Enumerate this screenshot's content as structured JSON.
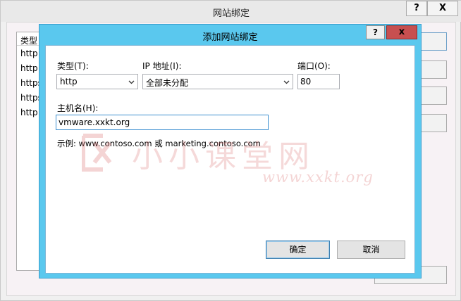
{
  "background_window": {
    "title": "网站绑定",
    "help_label": "?",
    "close_label": "X",
    "list_header": "类型",
    "list_items": [
      "http",
      "http",
      "https",
      "https",
      "http"
    ]
  },
  "dialog": {
    "title": "添加网站绑定",
    "help_label": "?",
    "close_label": "x",
    "type_label": "类型(T):",
    "type_value": "http",
    "ip_label": "IP 地址(I):",
    "ip_value": "全部未分配",
    "port_label": "端口(O):",
    "port_value": "80",
    "host_label": "主机名(H):",
    "host_value": "vmware.xxkt.org",
    "example_text": "示例: www.contoso.com 或 marketing.contoso.com",
    "ok_label": "确定",
    "cancel_label": "取消"
  },
  "watermark": {
    "text": "小小课堂网",
    "url": "www.xxkt.org"
  },
  "colors": {
    "dialog_frame": "#5ac8ee",
    "close_button": "#c74f50",
    "watermark": "#dc7878"
  }
}
